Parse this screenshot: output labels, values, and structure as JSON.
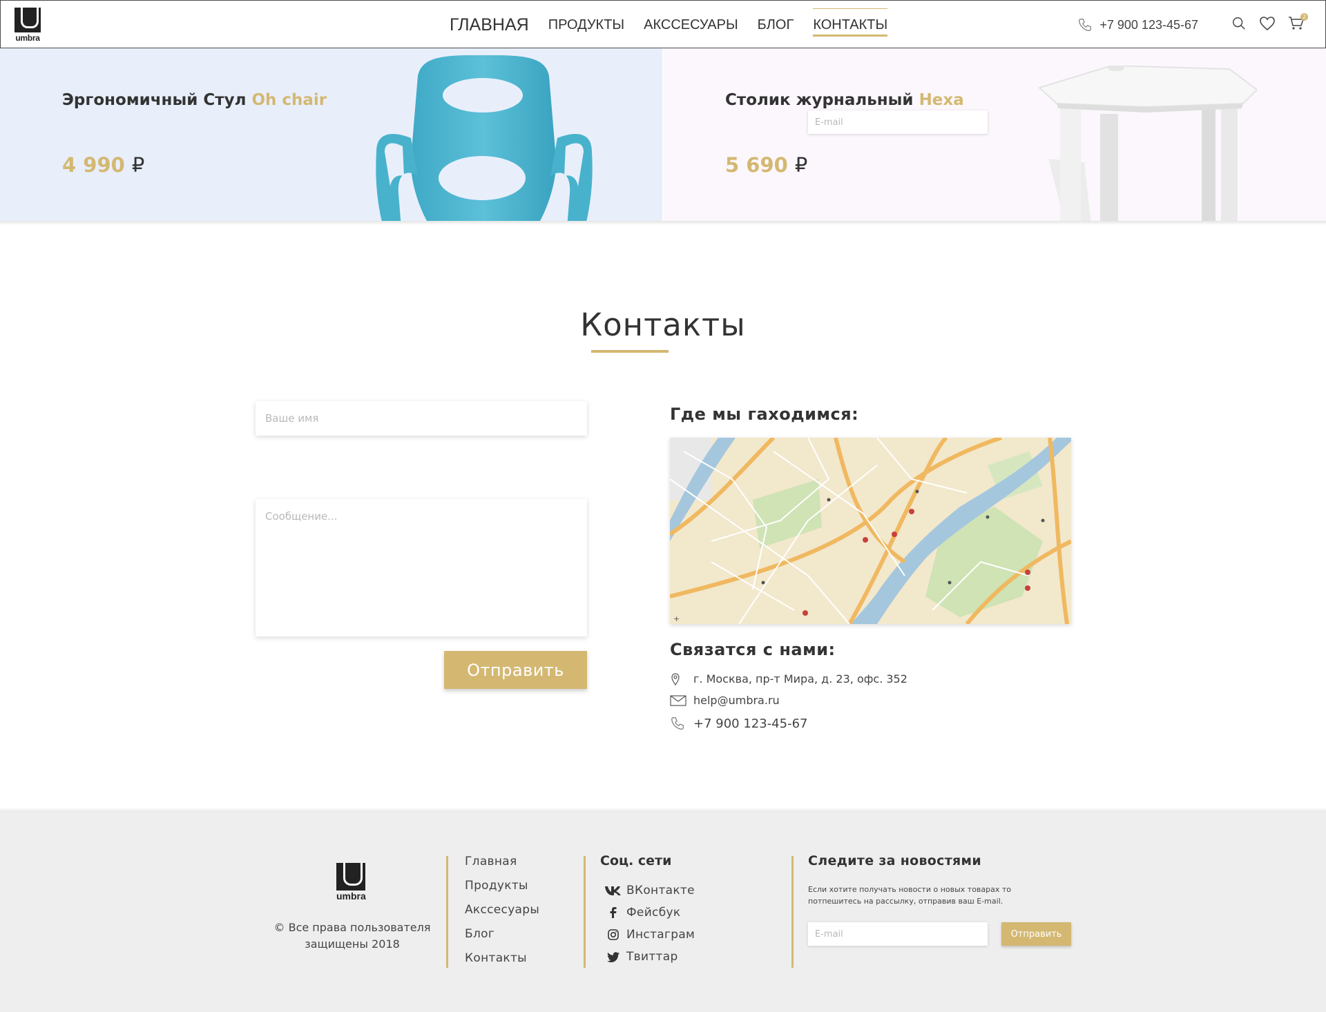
{
  "header": {
    "logo_text": "umbra",
    "nav": [
      "ГЛАВНАЯ",
      "ПРОДУКТЫ",
      "АКССЕСУАРЫ",
      "БЛОГ",
      "КОНТАКТЫ"
    ],
    "active_nav": "КОНТАКТЫ",
    "phone": "+7 900 123-45-67",
    "cart_count": "2",
    "icons": [
      "phone-icon",
      "search-icon",
      "heart-icon",
      "cart-icon"
    ]
  },
  "banners": [
    {
      "title": "Эргономичный Стул",
      "accent": "Oh chair",
      "price": "4 990",
      "currency": "₽"
    },
    {
      "title": "Столик журнальный",
      "accent": "Hexa",
      "price": "5 690",
      "currency": "₽"
    }
  ],
  "contacts": {
    "title": "Контакты",
    "form": {
      "name_placeholder": "Ваше имя",
      "email_placeholder": "E-mail",
      "message_placeholder": "Сообщение...",
      "submit_label": "Отправить"
    },
    "where_title": "Где мы гаходимся:",
    "contact_title": "Связатся с нами:",
    "address": "г. Москва, пр-т Мира, д. 23, офс. 352",
    "email": "help@umbra.ru",
    "phone": "+7 900 123-45-67"
  },
  "footer": {
    "logo_text": "umbra",
    "copyright_line1": "© Все права пользователя",
    "copyright_line2": "защищены 2018",
    "nav": [
      "Главная",
      "Продукты",
      "Акссесуары",
      "Блог",
      "Контакты"
    ],
    "social_title": "Соц. сети",
    "social": [
      {
        "label": "ВКонтакте",
        "icon": "vk-icon"
      },
      {
        "label": "Фейсбук",
        "icon": "facebook-icon"
      },
      {
        "label": "Инстаграм",
        "icon": "instagram-icon"
      },
      {
        "label": "Твиттар",
        "icon": "twitter-icon"
      }
    ],
    "news_title": "Следите за новостями",
    "news_text": "Если хотите получать новости о новых товарах то потпешитесь на рассылку, отправив ваш E-mail.",
    "email_placeholder": "E-mail",
    "send_label": "Отправить"
  },
  "colors": {
    "accent": "#d4b872",
    "text": "#333333",
    "banner1_bg": "#e8effb",
    "banner2_bg": "#fbf7fc",
    "footer_bg": "#eeeeee"
  }
}
